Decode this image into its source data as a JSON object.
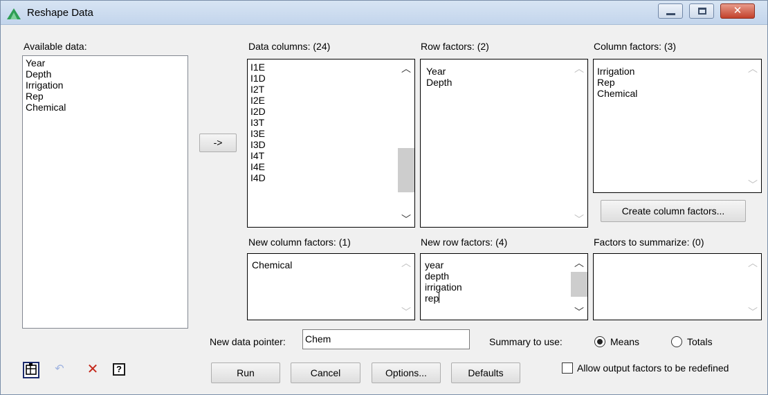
{
  "window": {
    "title": "Reshape Data"
  },
  "available": {
    "label": "Available data:",
    "items": [
      "Year",
      "Depth",
      "Irrigation",
      "Rep",
      "Chemical"
    ]
  },
  "arrow_button": {
    "label": "->"
  },
  "data_columns": {
    "label": "Data columns: (24)",
    "items": [
      "I1E",
      "I1D",
      "I2T",
      "I2E",
      "I2D",
      "I3T",
      "I3E",
      "I3D",
      "I4T",
      "I4E",
      "I4D"
    ]
  },
  "row_factors": {
    "label": "Row factors: (2)",
    "items": [
      "Year",
      "Depth"
    ]
  },
  "column_factors": {
    "label": "Column factors: (3)",
    "items": [
      "Irrigation",
      "Rep",
      "Chemical"
    ]
  },
  "create_column_factors": {
    "label": "Create column factors..."
  },
  "new_column_factors": {
    "label": "New column factors: (1)",
    "items": [
      "Chemical"
    ]
  },
  "new_row_factors": {
    "label": "New row factors: (4)",
    "items": [
      "year",
      "depth",
      "irrigation",
      "rep"
    ]
  },
  "factors_to_summarize": {
    "label": "Factors to summarize: (0)",
    "items": []
  },
  "pointer": {
    "label": "New data pointer:",
    "value": "Chem"
  },
  "summary": {
    "label": "Summary to use:",
    "options": [
      "Means",
      "Totals"
    ],
    "selected": "Means"
  },
  "buttons": {
    "run": "Run",
    "cancel": "Cancel",
    "options": "Options...",
    "defaults": "Defaults"
  },
  "allow_redefine": {
    "label": "Allow output factors to be redefined",
    "checked": false
  },
  "icons": {
    "app": "triangle-graph-icon",
    "tool1": "data-spreadsheet-icon",
    "tool2": "undo-icon",
    "tool3": "clear-cross-icon",
    "tool4": "help-icon"
  },
  "colors": {
    "title_bg": "#c9dbf0",
    "close": "#c8432d",
    "dialog_bg": "#f0f0f0",
    "app_icon": "#2e9e54"
  }
}
